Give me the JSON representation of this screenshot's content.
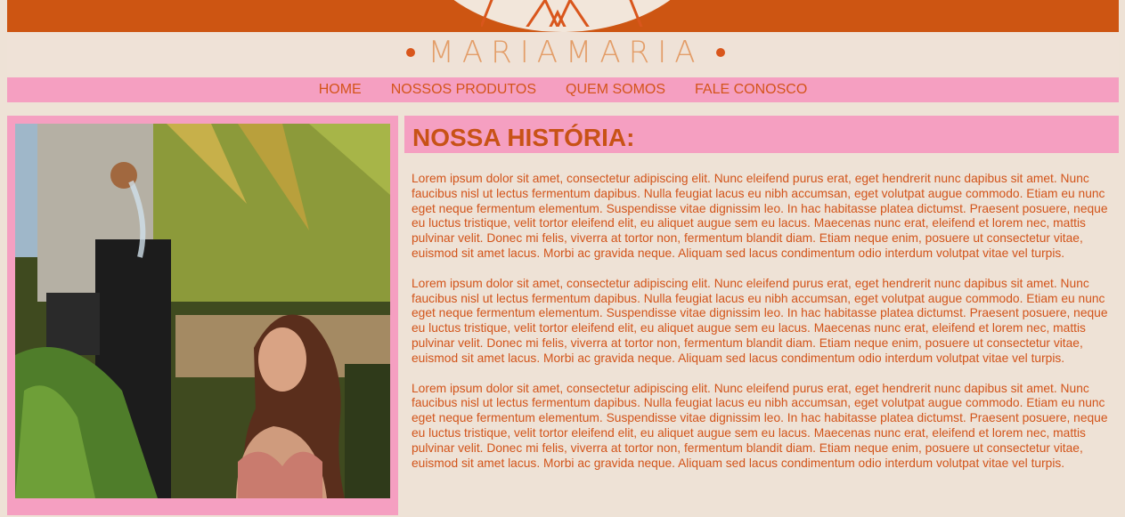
{
  "brand": {
    "name": "MARIAMARIA",
    "logo_icon": "mm-monogram-icon",
    "accent": "#cd5512",
    "pink": "#f59fc1"
  },
  "nav": {
    "items": [
      {
        "label": "HOME"
      },
      {
        "label": "NOSSOS PRODUTOS"
      },
      {
        "label": "QUEM SOMOS"
      },
      {
        "label": "FALE CONOSCO"
      }
    ]
  },
  "main": {
    "photo_alt": "woman-under-outdoor-shower-photo",
    "title": "NOSSA HISTÓRIA:",
    "paragraphs": [
      "Lorem ipsum dolor sit amet, consectetur adipiscing elit. Nunc eleifend purus erat, eget hendrerit nunc dapibus sit amet. Nunc faucibus nisl ut lectus fermentum dapibus. Nulla feugiat lacus eu nibh accumsan, eget volutpat augue commodo. Etiam eu nunc eget neque fermentum elementum. Suspendisse vitae dignissim leo. In hac habitasse platea dictumst. Praesent posuere, neque eu luctus tristique, velit tortor eleifend elit, eu aliquet augue sem eu lacus. Maecenas nunc erat, eleifend et lorem nec, mattis pulvinar velit. Donec mi felis, viverra at tortor non, fermentum blandit diam. Etiam neque enim, posuere ut consectetur vitae, euismod sit amet lacus. Morbi ac gravida neque. Aliquam sed lacus condimentum odio interdum volutpat vitae vel turpis.",
      "Lorem ipsum dolor sit amet, consectetur adipiscing elit. Nunc eleifend purus erat, eget hendrerit nunc dapibus sit amet. Nunc faucibus nisl ut lectus fermentum dapibus. Nulla feugiat lacus eu nibh accumsan, eget volutpat augue commodo. Etiam eu nunc eget neque fermentum elementum. Suspendisse vitae dignissim leo. In hac habitasse platea dictumst. Praesent posuere, neque eu luctus tristique, velit tortor eleifend elit, eu aliquet augue sem eu lacus. Maecenas nunc erat, eleifend et lorem nec, mattis pulvinar velit. Donec mi felis, viverra at tortor non, fermentum blandit diam. Etiam neque enim, posuere ut consectetur vitae, euismod sit amet lacus. Morbi ac gravida neque. Aliquam sed lacus condimentum odio interdum volutpat vitae vel turpis.",
      "Lorem ipsum dolor sit amet, consectetur adipiscing elit. Nunc eleifend purus erat, eget hendrerit nunc dapibus sit amet. Nunc faucibus nisl ut lectus fermentum dapibus. Nulla feugiat lacus eu nibh accumsan, eget volutpat augue commodo. Etiam eu nunc eget neque fermentum elementum. Suspendisse vitae dignissim leo. In hac habitasse platea dictumst. Praesent posuere, neque eu luctus tristique, velit tortor eleifend elit, eu aliquet augue sem eu lacus. Maecenas nunc erat, eleifend et lorem nec, mattis pulvinar velit. Donec mi felis, viverra at tortor non, fermentum blandit diam. Etiam neque enim, posuere ut consectetur vitae, euismod sit amet lacus. Morbi ac gravida neque. Aliquam sed lacus condimentum odio interdum volutpat vitae vel turpis."
    ]
  }
}
